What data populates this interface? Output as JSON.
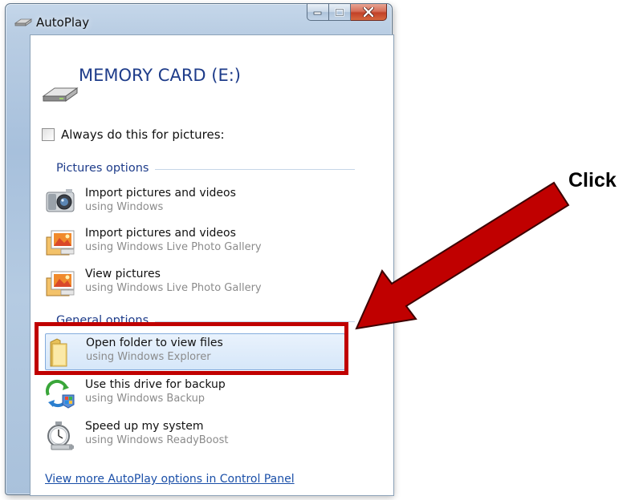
{
  "window": {
    "title": "AutoPlay",
    "caption_buttons": [
      "minimize",
      "maximize",
      "close"
    ],
    "close_color": "#c24128"
  },
  "device": {
    "title": "MEMORY CARD (E:)",
    "icon": "memory-card-drive-icon"
  },
  "always": {
    "label": "Always do this for pictures:",
    "checked": false
  },
  "sections": {
    "pictures": "Pictures options",
    "general": "General options"
  },
  "options": [
    {
      "title": "Import pictures and videos",
      "subtitle": "using Windows",
      "icon": "camera-icon"
    },
    {
      "title": "Import pictures and videos",
      "subtitle": "using Windows Live Photo Gallery",
      "icon": "photo-gallery-icon"
    },
    {
      "title": "View pictures",
      "subtitle": "using Windows Live Photo Gallery",
      "icon": "photo-gallery-icon"
    },
    {
      "title": "Open folder to view files",
      "subtitle": "using Windows Explorer",
      "icon": "folder-icon",
      "selected": true
    },
    {
      "title": "Use this drive for backup",
      "subtitle": "using Windows Backup",
      "icon": "backup-icon"
    },
    {
      "title": "Speed up my system",
      "subtitle": "using Windows ReadyBoost",
      "icon": "stopwatch-icon"
    }
  ],
  "control_panel_link": "View more AutoPlay options in Control Panel",
  "annotation": {
    "label": "Click",
    "color": "#c00000"
  }
}
